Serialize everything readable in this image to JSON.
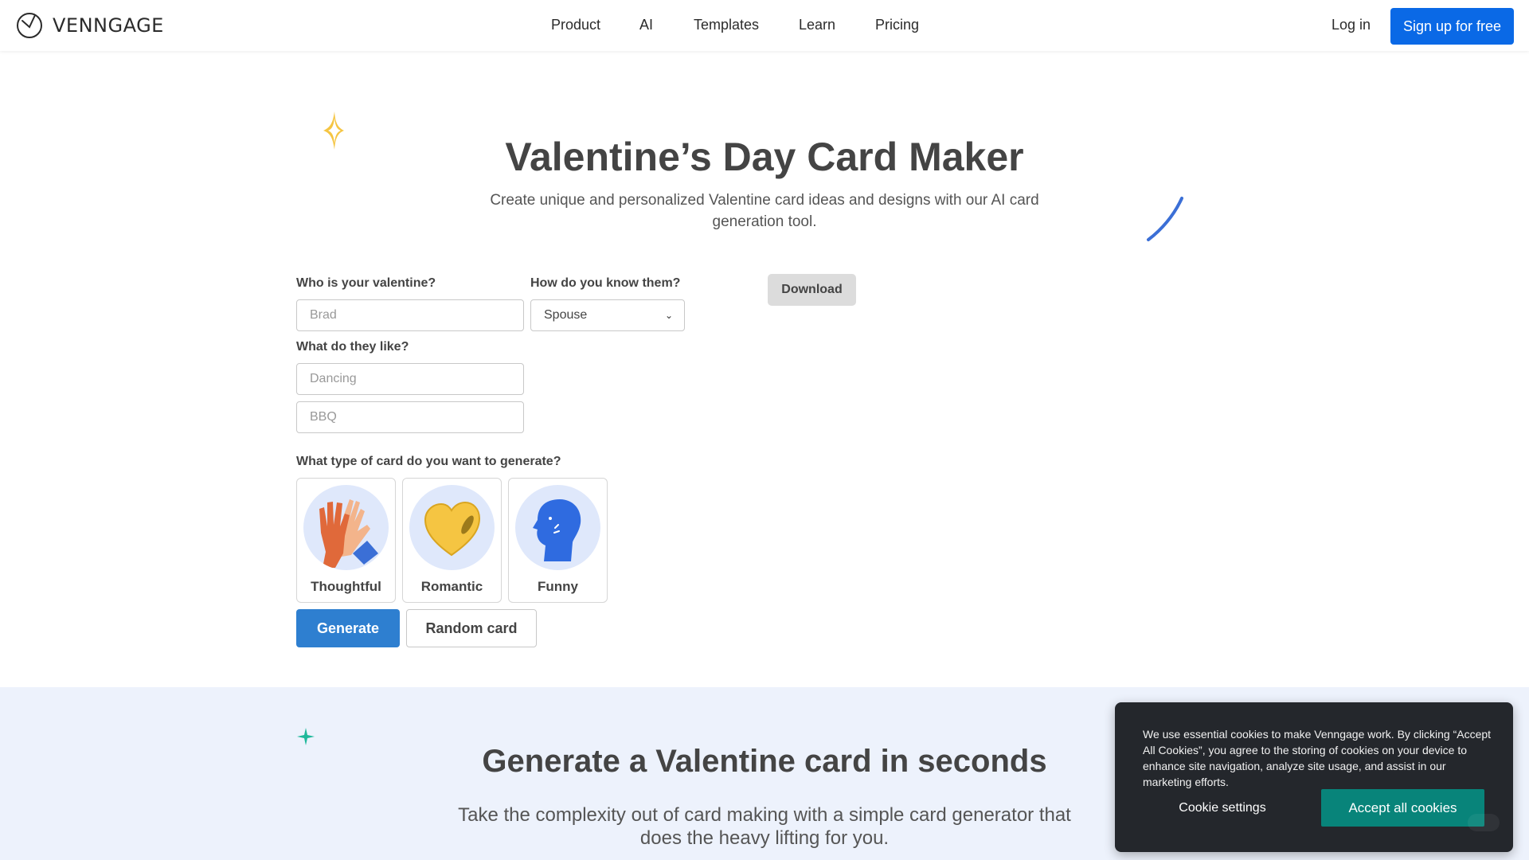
{
  "header": {
    "logo_text": "VENNGAGE",
    "nav": [
      {
        "label": "Product"
      },
      {
        "label": "AI"
      },
      {
        "label": "Templates"
      },
      {
        "label": "Learn"
      },
      {
        "label": "Pricing"
      }
    ],
    "login_label": "Log in",
    "signup_label": "Sign up for free"
  },
  "hero": {
    "title": "Valentine’s Day Card Maker",
    "subtitle": "Create unique and personalized Valentine card ideas and designs with our AI card generation tool."
  },
  "form": {
    "who_label": "Who is your valentine?",
    "who_placeholder": "Brad",
    "know_label": "How do you know them?",
    "know_value": "Spouse",
    "like_label": "What do they like?",
    "like_placeholder_1": "Dancing",
    "like_placeholder_2": "BBQ",
    "type_label": "What type of card do you want to generate?",
    "card_types": [
      {
        "label": "Thoughtful",
        "icon": "high-five-icon"
      },
      {
        "label": "Romantic",
        "icon": "heart-icon"
      },
      {
        "label": "Funny",
        "icon": "head-icon"
      }
    ],
    "generate_label": "Generate",
    "random_label": "Random card",
    "download_label": "Download"
  },
  "section2": {
    "title": "Generate a Valentine card in seconds",
    "subtitle": "Take the complexity out of card making with a simple card generator that does the heavy lifting for you."
  },
  "cookie": {
    "text": "We use essential cookies to make Venngage work. By clicking “Accept All Cookies”, you agree to the storing of cookies on your device to enhance site navigation, analyze site usage, and assist in our marketing efforts.",
    "settings_label": "Cookie settings",
    "accept_label": "Accept all cookies"
  },
  "colors": {
    "primary_blue": "#0a69e6",
    "generate_blue": "#2e7fd0",
    "cookie_bg": "#24272c",
    "accept_teal": "#08847a",
    "section_bg": "#edf2fc"
  }
}
